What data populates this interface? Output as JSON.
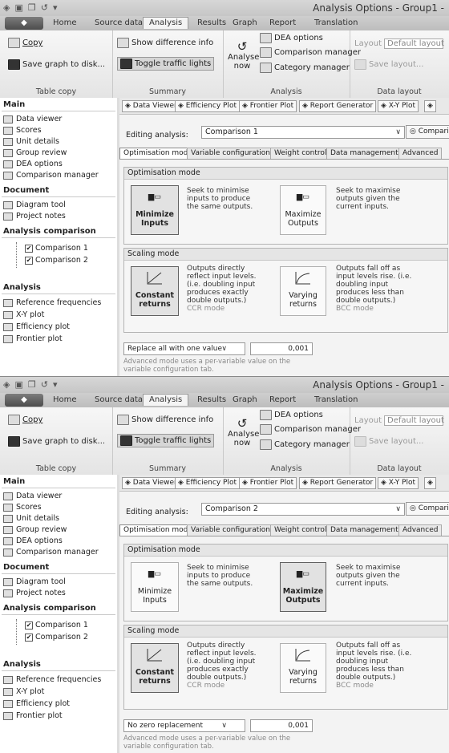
{
  "window": {
    "title": "Analysis Options - Group1 -"
  },
  "ribbon": {
    "app_button": "",
    "tabs": [
      "Home",
      "Source data",
      "Analysis",
      "Results",
      "Graph",
      "Report",
      "Translation"
    ],
    "table_copy": {
      "copy": "Copy",
      "save_graph": "Save graph to disk...",
      "label": "Table copy"
    },
    "summary": {
      "show_difference": "Show difference info",
      "toggle_traffic": "Toggle traffic lights",
      "label": "Summary"
    },
    "analysis": {
      "analyse_now_1": "Analyse",
      "analyse_now_2": "now",
      "dea_options": "DEA options",
      "comparison_manager": "Comparison manager",
      "category_manager": "Category manager",
      "label": "Analysis"
    },
    "data_layout": {
      "layout_label": "Layout",
      "layout_value": "Default layout",
      "save_layout": "Save layout...",
      "label": "Data layout"
    }
  },
  "sidebar": {
    "main_head": "Main",
    "main_items": [
      "Data viewer",
      "Scores",
      "Unit details",
      "Group review",
      "DEA options",
      "Comparison manager"
    ],
    "document_head": "Document",
    "document_items": [
      "Diagram tool",
      "Project notes"
    ],
    "analysis_comparison_head": "Analysis comparison",
    "comparisons": [
      "Comparison 1",
      "Comparison 2"
    ],
    "analysis_head": "Analysis",
    "analysis_items": [
      "Reference frequencies",
      "X-Y plot",
      "Efficiency plot",
      "Frontier plot"
    ]
  },
  "toolbar": [
    "Data Viewer",
    "Efficiency Plot",
    "Frontier Plot",
    "Report Generator",
    "X-Y Plot"
  ],
  "editing": {
    "label": "Editing analysis:",
    "comparison_button": "Comparison m"
  },
  "subtabs": [
    "Optimisation mode",
    "Variable configuration",
    "Weight control",
    "Data management",
    "Advanced"
  ],
  "optimisation": {
    "head": "Optimisation mode",
    "minimize_1": "Minimize",
    "minimize_2": "Inputs",
    "minimize_desc": "Seek to minimise inputs to produce the same outputs.",
    "maximize_1": "Maximize",
    "maximize_2": "Outputs",
    "maximize_desc": "Seek to maximise outputs given the current inputs."
  },
  "scaling": {
    "head": "Scaling mode",
    "constant_1": "Constant",
    "constant_2": "returns",
    "constant_desc": "Outputs directly reflect input levels. (i.e. doubling input produces exactly double outputs.)",
    "constant_sub": "CCR mode",
    "varying_1": "Varying",
    "varying_2": "returns",
    "varying_desc": "Outputs fall off as input levels rise. (i.e. doubling input produces less than double outputs.)",
    "varying_sub": "BCC mode"
  },
  "replacement_note": "Advanced mode uses a per-variable value on the variable configuration tab.",
  "panels": [
    {
      "editing_value": "Comparison 1",
      "replacement": "Replace all with one value",
      "replacement_value": "0,001",
      "optimisation_selected": "minimize",
      "scaling_selected": "constant"
    },
    {
      "editing_value": "Comparison 2",
      "replacement": "No zero replacement",
      "replacement_value": "0,001",
      "optimisation_selected": "maximize",
      "scaling_selected": "constant"
    }
  ],
  "icons": {
    "chevron": "chevron-down-icon",
    "check": "checkbox-icon"
  },
  "colors": {
    "ribbon_bg": "#e9e9e9",
    "app_button": "#5a5a5a",
    "selected_option": "#e2e2e2"
  }
}
